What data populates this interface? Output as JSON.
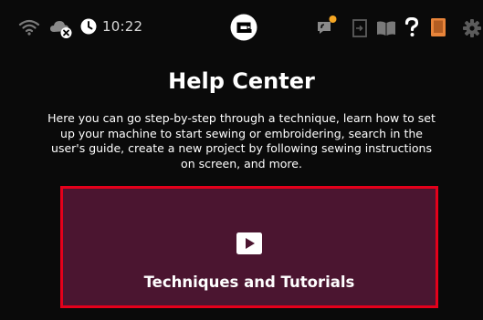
{
  "status_bar": {
    "time": "10:22",
    "icons": [
      "wifi-icon",
      "cloud-disconnected-icon",
      "clock-icon",
      "machine-connection-icon",
      "notification-icon",
      "exit-icon",
      "user-guide-icon",
      "help-icon",
      "tablet-icon",
      "settings-icon"
    ],
    "notification_dot_color": "#f5a623",
    "tablet_icon_color": "#e8843a"
  },
  "main": {
    "title": "Help Center",
    "description": "Here you can go step-by-step through a technique, learn how to set up your machine to start sewing or embroidering, search in the user's guide, create a new project by following sewing instructions on screen, and more."
  },
  "cards": [
    {
      "label": "Techniques and Tutorials",
      "icon": "play-icon",
      "background": "#4b1530",
      "border": "#e4001b"
    }
  ]
}
